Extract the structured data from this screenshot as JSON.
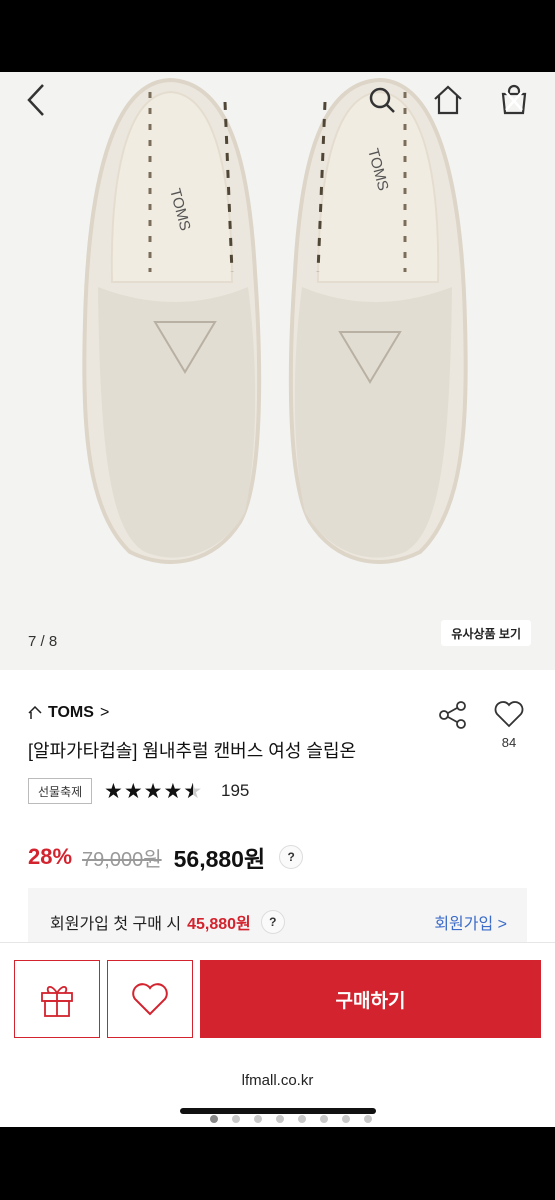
{
  "gallery": {
    "counter": "7 / 8",
    "similar_label": "유사상품 보기"
  },
  "product": {
    "brand": "TOMS",
    "brand_chevron": ">",
    "title": "[알파가타컵솔] 웜내추럴 캔버스 여성 슬립온",
    "like_count": "84",
    "tag": "선물축제",
    "rating": 4.5,
    "review_count": "195",
    "discount": "28%",
    "original_price": "79,000원",
    "final_price": "56,880원",
    "question_mark": "?"
  },
  "member": {
    "text": "회원가입 첫 구매 시",
    "price": "45,880원",
    "question_mark": "?",
    "link": "회원가입 >"
  },
  "actions": {
    "buy_label": "구매하기"
  },
  "browser": {
    "domain": "lfmall.co.kr"
  },
  "colors": {
    "accent": "#d3232e",
    "link": "#3b6cc9",
    "image_bg": "#f3f3f2"
  },
  "icons": [
    "back-arrow-icon",
    "search-icon",
    "home-icon",
    "cart-icon",
    "close-icon",
    "share-icon",
    "heart-icon",
    "gift-icon",
    "star-icon"
  ]
}
